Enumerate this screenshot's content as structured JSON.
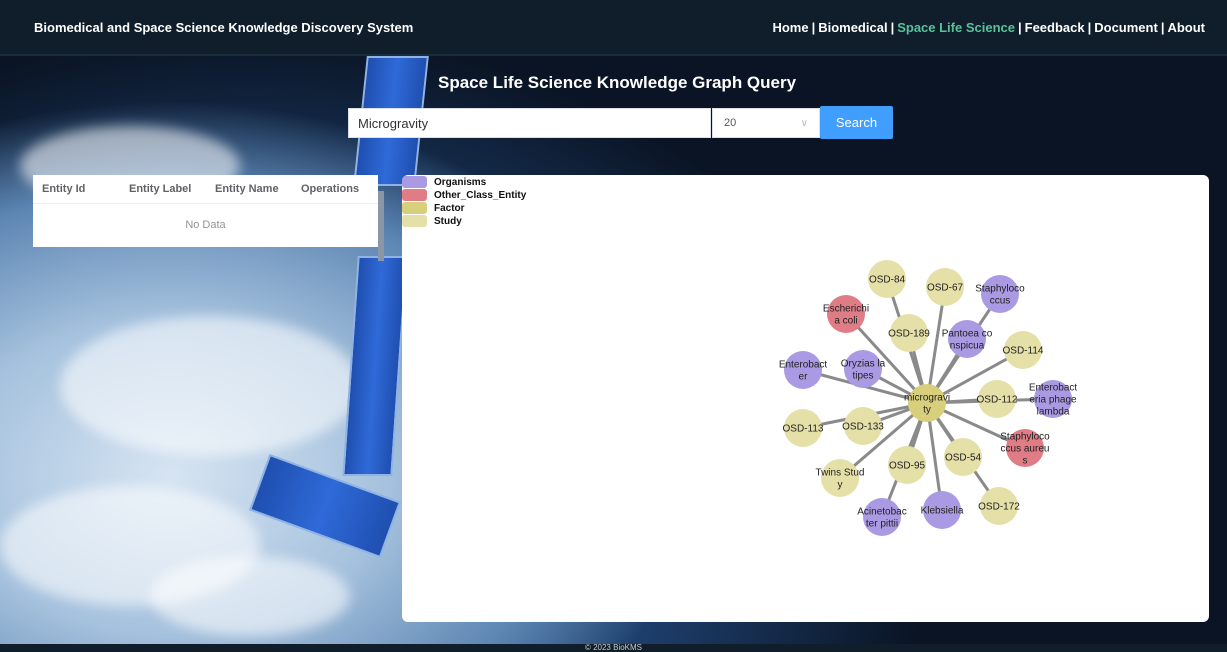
{
  "header": {
    "brand": "Biomedical and Space Science Knowledge Discovery System",
    "nav": [
      {
        "label": "Home",
        "active": false
      },
      {
        "label": "Biomedical",
        "active": false
      },
      {
        "label": "Space Life Science",
        "active": true
      },
      {
        "label": "Feedback",
        "active": false
      },
      {
        "label": "Document",
        "active": false
      },
      {
        "label": "About",
        "active": false
      }
    ],
    "active_color": "#58c29a"
  },
  "query": {
    "title": "Space Life Science Knowledge Graph Query",
    "search_value": "Microgravity",
    "limit_value": "20",
    "search_button": "Search"
  },
  "table": {
    "columns": [
      "Entity Id",
      "Entity Label",
      "Entity Name",
      "Operations"
    ],
    "empty_text": "No Data"
  },
  "legend": [
    {
      "label": "Organisms",
      "color": "#a99ae3"
    },
    {
      "label": "Other_Class_Entity",
      "color": "#e07c86"
    },
    {
      "label": "Factor",
      "color": "#d8cf7d"
    },
    {
      "label": "Study",
      "color": "#e5dfa8"
    }
  ],
  "graph": {
    "center": {
      "label": "microgravity",
      "lines": [
        "microgravi",
        "ty"
      ],
      "type": "Factor"
    },
    "nodes": [
      {
        "label": "OSD-84",
        "lines": [
          "OSD-84"
        ],
        "type": "Study"
      },
      {
        "label": "OSD-67",
        "lines": [
          "OSD-67"
        ],
        "type": "Study"
      },
      {
        "label": "Staphylococcus",
        "lines": [
          "Staphyloco",
          "ccus"
        ],
        "type": "Organisms"
      },
      {
        "label": "Escherichia coli",
        "lines": [
          "Escherichi",
          "a coli"
        ],
        "type": "Other_Class_Entity"
      },
      {
        "label": "OSD-189",
        "lines": [
          "OSD-189"
        ],
        "type": "Study"
      },
      {
        "label": "Pantoea conspicua",
        "lines": [
          "Pantoea co",
          "nspicua"
        ],
        "type": "Organisms"
      },
      {
        "label": "OSD-114",
        "lines": [
          "OSD-114"
        ],
        "type": "Study"
      },
      {
        "label": "Enterobacter",
        "lines": [
          "Enterobact",
          "er"
        ],
        "type": "Organisms"
      },
      {
        "label": "Oryzias latipes",
        "lines": [
          "Oryzias la",
          "tipes"
        ],
        "type": "Organisms"
      },
      {
        "label": "OSD-112",
        "lines": [
          "OSD-112"
        ],
        "type": "Study"
      },
      {
        "label": "Enterobacteria phage lambda",
        "lines": [
          "Enterobact",
          "eria phage",
          "lambda"
        ],
        "type": "Organisms"
      },
      {
        "label": "OSD-113",
        "lines": [
          "OSD-113"
        ],
        "type": "Study"
      },
      {
        "label": "OSD-133",
        "lines": [
          "OSD-133"
        ],
        "type": "Study"
      },
      {
        "label": "Staphylococcus aureus",
        "lines": [
          "Staphyloco",
          "ccus aureu",
          "s"
        ],
        "type": "Other_Class_Entity"
      },
      {
        "label": "OSD-54",
        "lines": [
          "OSD-54"
        ],
        "type": "Study"
      },
      {
        "label": "OSD-95",
        "lines": [
          "OSD-95"
        ],
        "type": "Study"
      },
      {
        "label": "Twins Study",
        "lines": [
          "Twins Stud",
          "y"
        ],
        "type": "Study"
      },
      {
        "label": "OSD-172",
        "lines": [
          "OSD-172"
        ],
        "type": "Study"
      },
      {
        "label": "Acinetobacter pittii",
        "lines": [
          "Acinetobac",
          "ter pittii"
        ],
        "type": "Organisms"
      },
      {
        "label": "Klebsiella",
        "lines": [
          "Klebsiella"
        ],
        "type": "Organisms"
      }
    ]
  },
  "footer": {
    "text": "© 2023 BioKMS"
  }
}
